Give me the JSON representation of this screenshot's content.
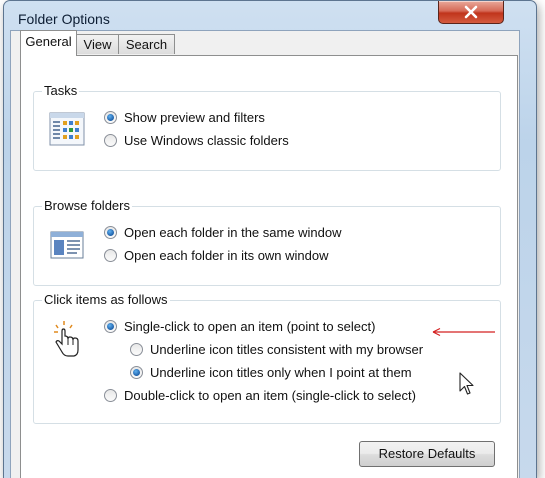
{
  "window": {
    "title": "Folder Options"
  },
  "tabs": [
    {
      "label": "General",
      "active": true
    },
    {
      "label": "View",
      "active": false
    },
    {
      "label": "Search",
      "active": false
    }
  ],
  "groups": {
    "tasks": {
      "label": "Tasks",
      "icon": "preview-pane-icon",
      "options": [
        {
          "label": "Show preview and filters",
          "checked": true
        },
        {
          "label": "Use Windows classic folders",
          "checked": false
        }
      ]
    },
    "browse": {
      "label": "Browse folders",
      "icon": "window-icon",
      "options": [
        {
          "label": "Open each folder in the same window",
          "checked": true
        },
        {
          "label": "Open each folder in its own window",
          "checked": false
        }
      ]
    },
    "click": {
      "label": "Click items as follows",
      "icon": "hand-pointer-icon",
      "options": [
        {
          "label": "Single-click to open an item (point to select)",
          "checked": true
        },
        {
          "label": "Underline icon titles consistent with my browser",
          "checked": false
        },
        {
          "label": "Underline icon titles only when I point at them",
          "checked": true
        },
        {
          "label": "Double-click to open an item (single-click to select)",
          "checked": false
        }
      ]
    }
  },
  "buttons": {
    "restore_defaults": "Restore Defaults"
  },
  "colors": {
    "annotation_arrow": "#d32020",
    "close_button": "#c0341c"
  }
}
